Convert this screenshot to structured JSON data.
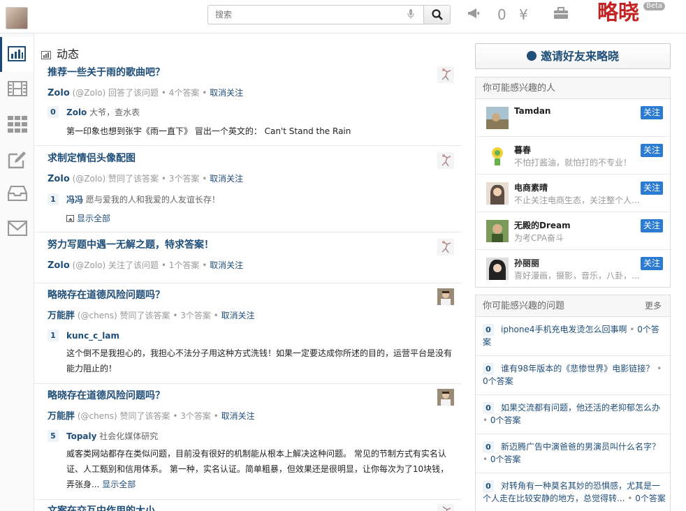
{
  "search": {
    "placeholder": "搜索"
  },
  "top": {
    "counter": "0",
    "currency_glyph": "¥",
    "brand": "略晓",
    "beta": "Beta"
  },
  "nav": {
    "items": [
      {
        "name": "nav-activity",
        "icon": "bar-chart-icon",
        "active": true
      },
      {
        "name": "nav-videos",
        "icon": "film-icon",
        "active": false
      },
      {
        "name": "nav-apps",
        "icon": "grid-icon",
        "active": false
      },
      {
        "name": "nav-write",
        "icon": "edit-icon",
        "active": false
      },
      {
        "name": "nav-inbox",
        "icon": "inbox-icon",
        "active": false
      },
      {
        "name": "nav-mail",
        "icon": "mail-icon",
        "active": false
      }
    ]
  },
  "feed": {
    "title": "动态",
    "items": [
      {
        "title": "推荐一些关于雨的歌曲吧？",
        "user": "Zolo",
        "handle": "(@Zolo)",
        "action": "回答了该问题",
        "answers": "4个答案",
        "unfollow": "取消关注",
        "vote": "0",
        "author": "Zolo",
        "bio": "大爷，查水表",
        "body": "第一印象也想到张宇《雨一直下》 冒出一个英文的： Can't Stand the Rain"
      },
      {
        "title": "求制定情侣头像配图",
        "user": "Zolo",
        "handle": "(@Zolo)",
        "action": "赞同了该答案",
        "answers": "3个答案",
        "unfollow": "取消关注",
        "vote": "1",
        "author": "冯冯",
        "bio": "愿与爱我的人和我爱的人友谊长存！",
        "show_all": "显示全部"
      },
      {
        "title": "努力写题中遇一无解之题，特求答案！",
        "user": "Zolo",
        "handle": "(@Zolo)",
        "action": "关注了该问题",
        "answers": "1个答案",
        "unfollow": "取消关注"
      },
      {
        "title": "略晓存在道德风险问题吗？",
        "user": "万能胖",
        "handle": "(@chens)",
        "action": "赞同了该答案",
        "answers": "3个答案",
        "unfollow": "取消关注",
        "vote": "1",
        "author": "kunc_c_lam",
        "bio": "",
        "body": "这个倒不是我担心的，我担心不法分子用这种方式洗钱！如果一定要达成你所述的目的，运营平台是没有能力阻止的！"
      },
      {
        "title": "略晓存在道德风险问题吗？",
        "user": "万能胖",
        "handle": "(@chens)",
        "action": "赞同了该答案",
        "answers": "3个答案",
        "unfollow": "取消关注",
        "vote": "5",
        "author": "Topaly",
        "bio": "社会化媒体研究",
        "body": "威客类网站都存在类似问题，目前没有很好的机制能从根本上解决这种问题。 常见的节制方式有实名认证、人工甄别和信用体系。 第一种，实名认证。简单粗暴，但效果还是很明显，让你每次为了10块钱，弄张身...",
        "show_all": "显示全部"
      },
      {
        "title": "文案在交互中作用的大小"
      }
    ]
  },
  "sidebar": {
    "invite": "邀请好友来略晓",
    "people_title": "你可能感兴趣的人",
    "follow_label": "关注",
    "people": [
      {
        "name": "Tamdan",
        "desc": ""
      },
      {
        "name": "暮春",
        "desc": "不怕打酱油，就怕打的不专业！"
      },
      {
        "name": "电商素晴",
        "desc": "不止关注电商生态，关注整个人..."
      },
      {
        "name": "无殿的Dream",
        "desc": "为考CPA奋斗"
      },
      {
        "name": "孙丽丽",
        "desc": "喜好漫画，摄影，音乐，八卦，..."
      }
    ],
    "questions_title": "你可能感兴趣的问题",
    "more": "更多",
    "questions": [
      {
        "count": "0",
        "text": "iphone4手机充电发烫怎么回事啊",
        "answers": "0个答案"
      },
      {
        "count": "0",
        "text": "谁有98年版本的《悲惨世界》电影链接？",
        "answers": "0个答案"
      },
      {
        "count": "0",
        "text": "如果交流都有问题，他还活的老抑郁怎么办",
        "answers": "0个答案"
      },
      {
        "count": "0",
        "text": "新迈腾广告中演爸爸的男演员叫什么名字？",
        "answers": "0个答案"
      },
      {
        "count": "0",
        "text": "对转角有一种莫名其妙的恐惧感，尤其是一个人走在比较安静的地方，总觉得转...",
        "answers": "0个答案"
      }
    ]
  }
}
